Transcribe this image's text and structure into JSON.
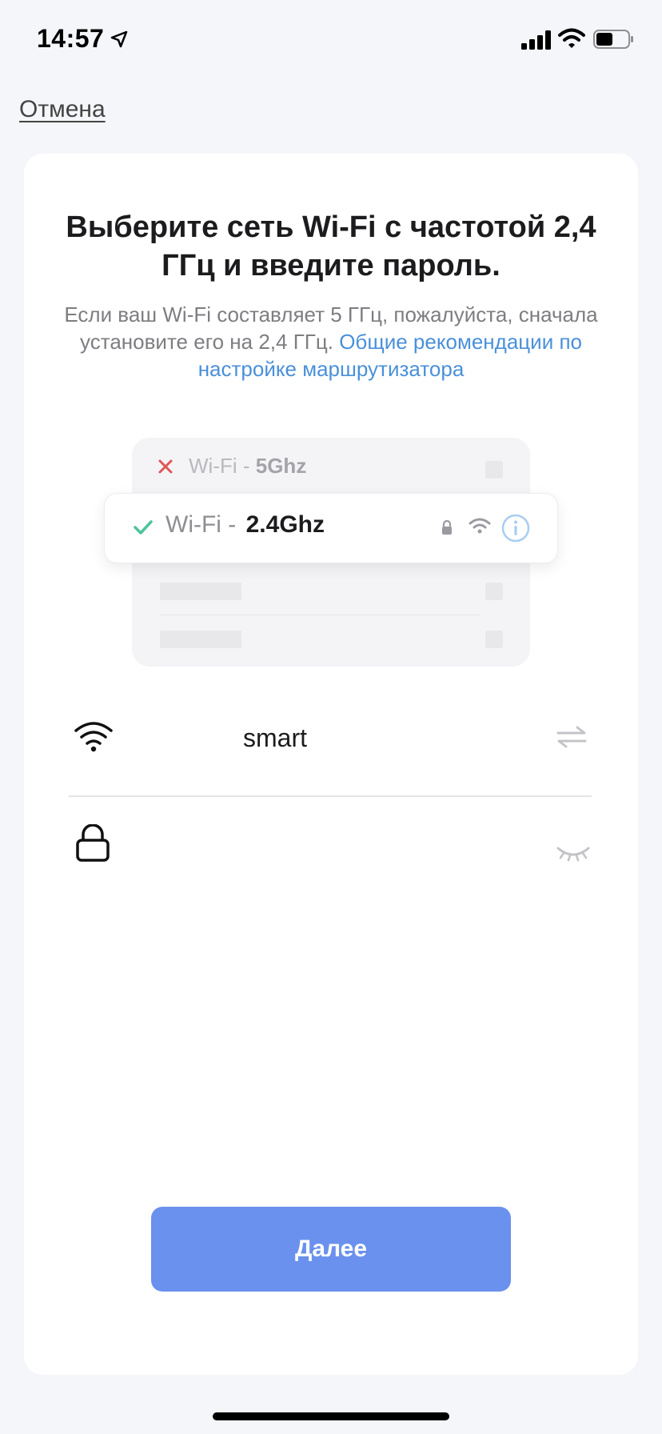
{
  "status_bar": {
    "time": "14:57",
    "icons": [
      "location-arrow-icon",
      "cellular-signal-icon",
      "wifi-icon",
      "battery-icon"
    ]
  },
  "nav": {
    "cancel_label": "Отмена"
  },
  "card": {
    "title": "Выберите сеть Wi-Fi с частотой 2,4 ГГц и введите пароль.",
    "subtitle_text": "Если ваш Wi-Fi составляет 5 ГГц, пожалуйста, сначала установите его на 2,4 ГГц. ",
    "subtitle_link": "Общие рекомендации по настройке маршрутизатора"
  },
  "illustration": {
    "bad_network_prefix": "Wi-Fi - ",
    "bad_network_band": "5Ghz",
    "good_network_prefix": "Wi-Fi - ",
    "good_network_band": "2.4Ghz"
  },
  "form": {
    "ssid_value": "smart",
    "password_value": "",
    "password_placeholder": ""
  },
  "actions": {
    "next_label": "Далее"
  },
  "colors": {
    "accent": "#6a91ed",
    "link": "#4a90d9",
    "error_x": "#e05555",
    "success_check": "#4cc49b"
  }
}
